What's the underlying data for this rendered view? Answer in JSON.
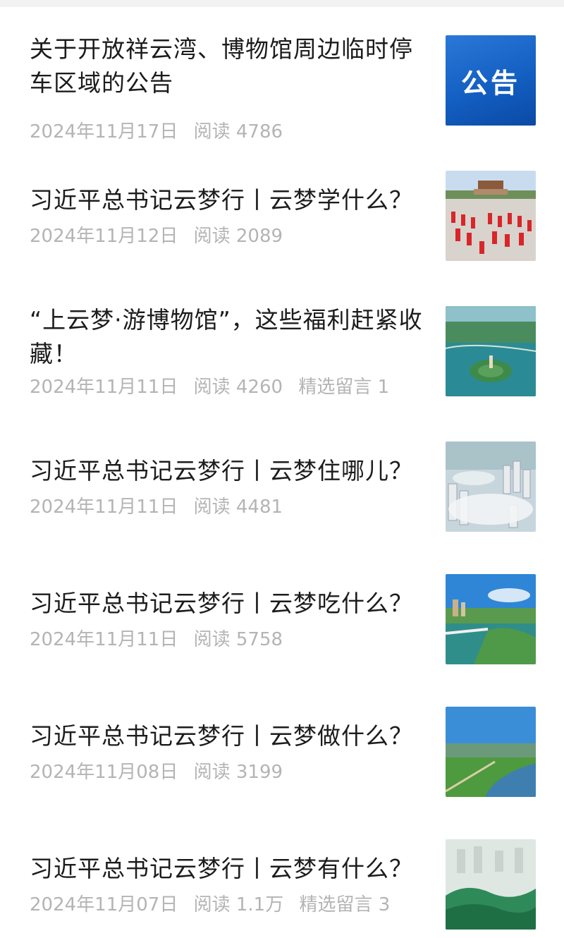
{
  "articles": [
    {
      "title": "关于开放祥云湾、博物馆周边临时停车区域的公告",
      "date": "2024年11月17日",
      "reads": "阅读 4786",
      "comments": "",
      "thumb_text": "公告"
    },
    {
      "title": "习近平总书记云梦行丨云梦学什么？",
      "date": "2024年11月12日",
      "reads": "阅读 2089",
      "comments": ""
    },
    {
      "title": "“上云梦·游博物馆”，这些福利赶紧收藏！",
      "date": "2024年11月11日",
      "reads": "阅读 4260",
      "comments": "精选留言 1"
    },
    {
      "title": "习近平总书记云梦行丨云梦住哪儿？",
      "date": "2024年11月11日",
      "reads": "阅读 4481",
      "comments": ""
    },
    {
      "title": "习近平总书记云梦行丨云梦吃什么？",
      "date": "2024年11月11日",
      "reads": "阅读 5758",
      "comments": ""
    },
    {
      "title": "习近平总书记云梦行丨云梦做什么？",
      "date": "2024年11月08日",
      "reads": "阅读 3199",
      "comments": ""
    },
    {
      "title": "习近平总书记云梦行丨云梦有什么？",
      "date": "2024年11月07日",
      "reads": "阅读 1.1万",
      "comments": "精选留言 3"
    }
  ],
  "colors": {
    "title": "#1c1c1c",
    "meta": "#b4b4b4",
    "notice_bg": "#1a66cc"
  }
}
